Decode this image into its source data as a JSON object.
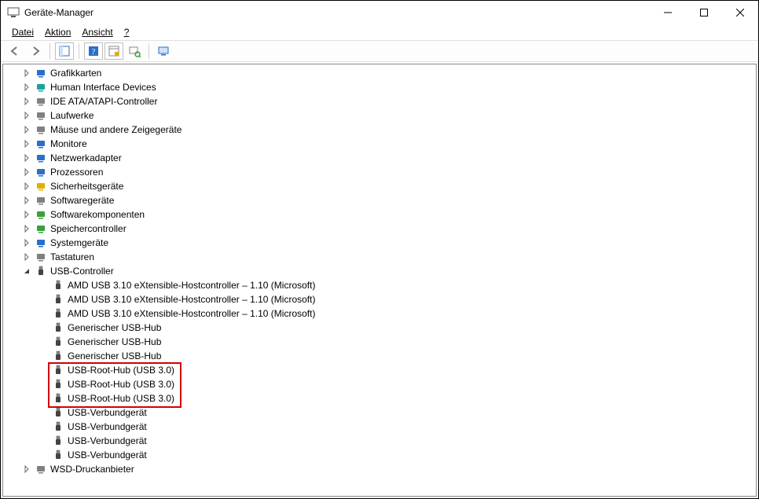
{
  "window": {
    "title": "Geräte-Manager"
  },
  "menu": {
    "file": "Datei",
    "action": "Aktion",
    "view": "Ansicht",
    "help": "?"
  },
  "tree": {
    "categories": [
      {
        "label": "Grafikkarten",
        "expanded": false,
        "iconColor": "#2a6fc9"
      },
      {
        "label": "Human Interface Devices",
        "expanded": false,
        "iconColor": "#1aa39a"
      },
      {
        "label": "IDE ATA/ATAPI-Controller",
        "expanded": false,
        "iconColor": "#808080"
      },
      {
        "label": "Laufwerke",
        "expanded": false,
        "iconColor": "#808080"
      },
      {
        "label": "Mäuse und andere Zeigegeräte",
        "expanded": false,
        "iconColor": "#808080"
      },
      {
        "label": "Monitore",
        "expanded": false,
        "iconColor": "#2a6fc9"
      },
      {
        "label": "Netzwerkadapter",
        "expanded": false,
        "iconColor": "#2a6fc9"
      },
      {
        "label": "Prozessoren",
        "expanded": false,
        "iconColor": "#2a6fc9"
      },
      {
        "label": "Sicherheitsgeräte",
        "expanded": false,
        "iconColor": "#e0b000"
      },
      {
        "label": "Softwaregeräte",
        "expanded": false,
        "iconColor": "#808080"
      },
      {
        "label": "Softwarekomponenten",
        "expanded": false,
        "iconColor": "#3aa03a"
      },
      {
        "label": "Speichercontroller",
        "expanded": false,
        "iconColor": "#3aa03a"
      },
      {
        "label": "Systemgeräte",
        "expanded": false,
        "iconColor": "#2a6fc9"
      },
      {
        "label": "Tastaturen",
        "expanded": false,
        "iconColor": "#808080"
      },
      {
        "label": "USB-Controller",
        "expanded": true,
        "iconColor": "#444",
        "children": [
          {
            "label": "AMD USB 3.10 eXtensible-Hostcontroller – 1.10 (Microsoft)"
          },
          {
            "label": "AMD USB 3.10 eXtensible-Hostcontroller – 1.10 (Microsoft)"
          },
          {
            "label": "AMD USB 3.10 eXtensible-Hostcontroller – 1.10 (Microsoft)"
          },
          {
            "label": "Generischer USB-Hub"
          },
          {
            "label": "Generischer USB-Hub"
          },
          {
            "label": "Generischer USB-Hub"
          },
          {
            "label": "USB-Root-Hub (USB 3.0)",
            "highlighted": true
          },
          {
            "label": "USB-Root-Hub (USB 3.0)",
            "highlighted": true
          },
          {
            "label": "USB-Root-Hub (USB 3.0)",
            "highlighted": true
          },
          {
            "label": "USB-Verbundgerät"
          },
          {
            "label": "USB-Verbundgerät"
          },
          {
            "label": "USB-Verbundgerät"
          },
          {
            "label": "USB-Verbundgerät"
          }
        ]
      },
      {
        "label": "WSD-Druckanbieter",
        "expanded": false,
        "iconColor": "#808080"
      }
    ]
  }
}
